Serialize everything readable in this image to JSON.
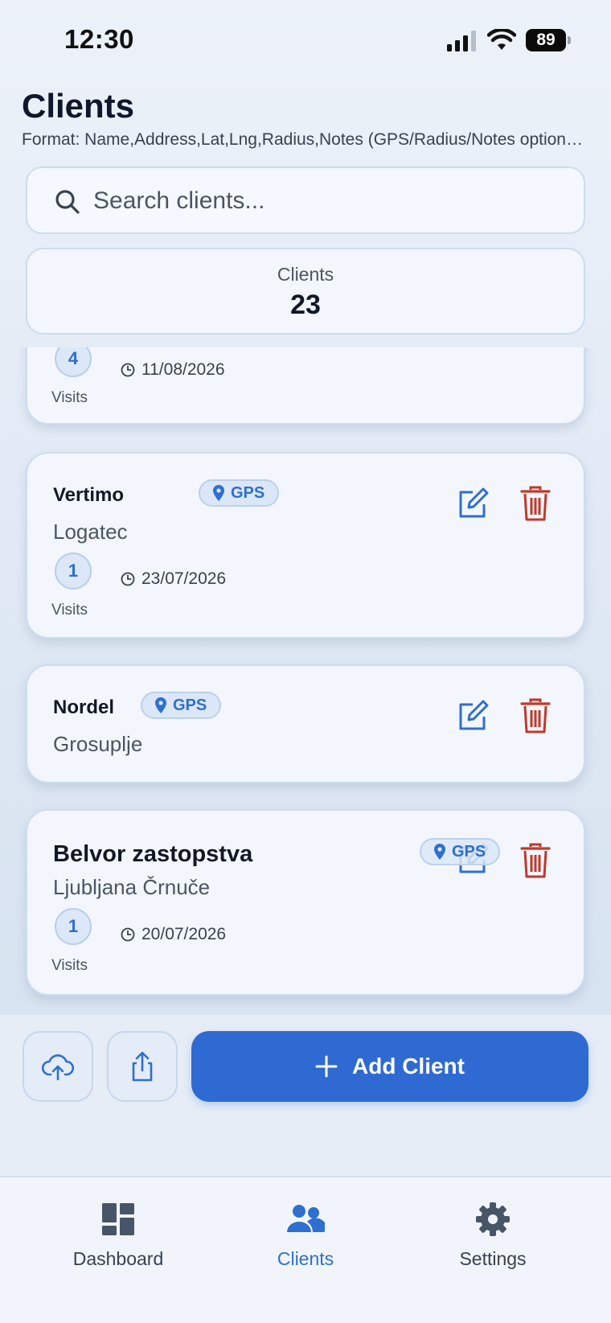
{
  "status_bar": {
    "time": "12:30",
    "battery": "89"
  },
  "header": {
    "title": "Clients",
    "format_hint": "Format: Name,Address,Lat,Lng,Radius,Notes (GPS/Radius/Notes optional)"
  },
  "search": {
    "placeholder": "Search clients..."
  },
  "summary": {
    "label": "Clients",
    "count": "23"
  },
  "clients": [
    {
      "name": "",
      "city": "",
      "gps": "",
      "visits": "4",
      "visits_label": "Visits",
      "last_visit": "11/08/2026"
    },
    {
      "name": "Vertimo",
      "city": "Logatec",
      "gps": "GPS",
      "visits": "1",
      "visits_label": "Visits",
      "last_visit": "23/07/2026"
    },
    {
      "name": "Nordel",
      "city": "Grosuplje",
      "gps": "GPS"
    },
    {
      "name": "Belvor zastopstva",
      "city": "Ljubljana Črnuče",
      "gps": "GPS",
      "visits": "1",
      "visits_label": "Visits",
      "last_visit": "20/07/2026"
    }
  ],
  "actions": {
    "add_label": "Add Client"
  },
  "tabs": [
    {
      "label": "Dashboard",
      "icon": "dashboard-icon"
    },
    {
      "label": "Clients",
      "icon": "clients-icon",
      "active": true
    },
    {
      "label": "Settings",
      "icon": "gear-icon"
    }
  ],
  "colors": {
    "accent": "#2f6ad2",
    "danger": "#c0392b",
    "background": "#e4ecf7"
  }
}
